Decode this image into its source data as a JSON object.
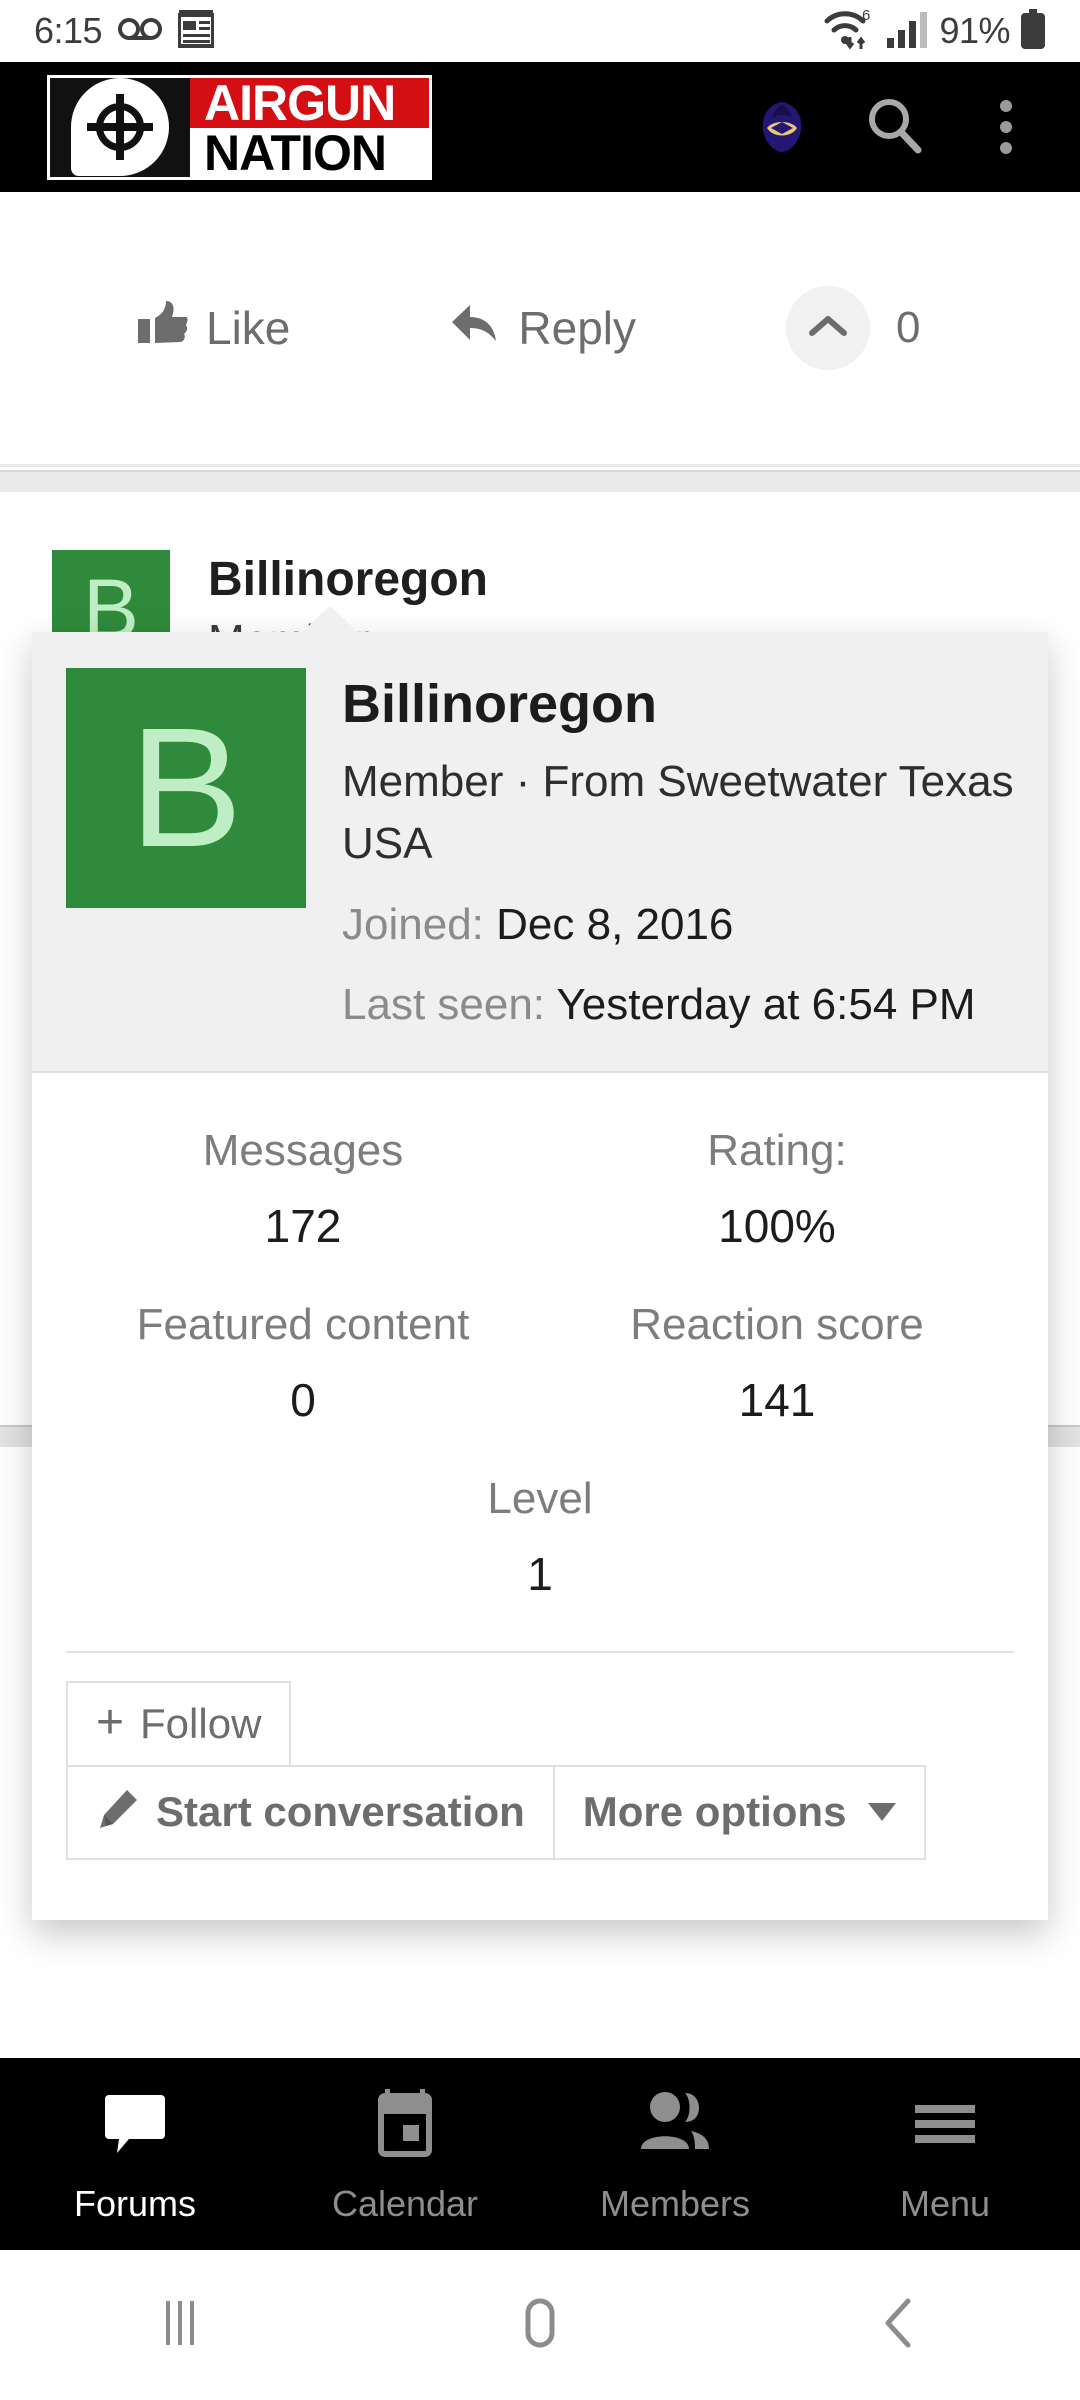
{
  "status_bar": {
    "time": "6:15",
    "icons_left": [
      "voicemail-icon",
      "news-icon"
    ],
    "wifi_label": "6",
    "battery_percent": "91%",
    "icons_right": [
      "wifi-6-icon",
      "cellular-signal-icon",
      "battery-icon"
    ]
  },
  "header": {
    "logo_line1": "AIRGUN",
    "logo_line2": "NATION",
    "logo_mark": "crosshair-target-icon",
    "avatar_icon": "raven-avatar-icon",
    "search_icon": "search-icon",
    "overflow_icon": "kebab-menu-icon"
  },
  "post_actions": {
    "like_label": "Like",
    "like_icon": "thumbs-up-icon",
    "reply_label": "Reply",
    "reply_icon": "reply-arrow-icon",
    "vote_icon": "chevron-up-icon",
    "vote_count": "0"
  },
  "post": {
    "avatar_letter": "B",
    "username": "Billinoregon",
    "subtitle": "Member ·"
  },
  "member_card": {
    "avatar_letter": "B",
    "username": "Billinoregon",
    "role_location": "Member · From Sweetwater Texas USA",
    "joined_label": "Joined:",
    "joined_value": "Dec 8, 2016",
    "last_seen_label": "Last seen:",
    "last_seen_value": "Yesterday at 6:54 PM",
    "stats": [
      {
        "label": "Messages",
        "value": "172"
      },
      {
        "label": "Rating:",
        "value": "100%"
      },
      {
        "label": "Featured content",
        "value": "0"
      },
      {
        "label": "Reaction score",
        "value": "141"
      },
      {
        "label": "Level",
        "value": "1"
      }
    ],
    "follow_label": "Follow",
    "follow_icon": "plus-icon",
    "start_conversation_label": "Start conversation",
    "start_conversation_icon": "pencil-icon",
    "more_options_label": "More options",
    "more_options_icon": "caret-down-icon"
  },
  "bottom_nav": {
    "items": [
      {
        "label": "Forums",
        "icon": "chat-bubble-icon",
        "active": true
      },
      {
        "label": "Calendar",
        "icon": "calendar-icon",
        "active": false
      },
      {
        "label": "Members",
        "icon": "people-icon",
        "active": false
      },
      {
        "label": "Menu",
        "icon": "hamburger-icon",
        "active": false
      }
    ]
  },
  "android_nav": {
    "recents_icon": "recents-icon",
    "home_icon": "home-icon",
    "back_icon": "back-chevron-icon"
  },
  "colors": {
    "header_bg": "#000000",
    "brand_red": "#d40f14",
    "avatar_green": "#2f8a3b",
    "avatar_letter": "#bfeec4",
    "card_head_bg": "#f0f0f0",
    "muted_text": "#7d7d7d"
  }
}
